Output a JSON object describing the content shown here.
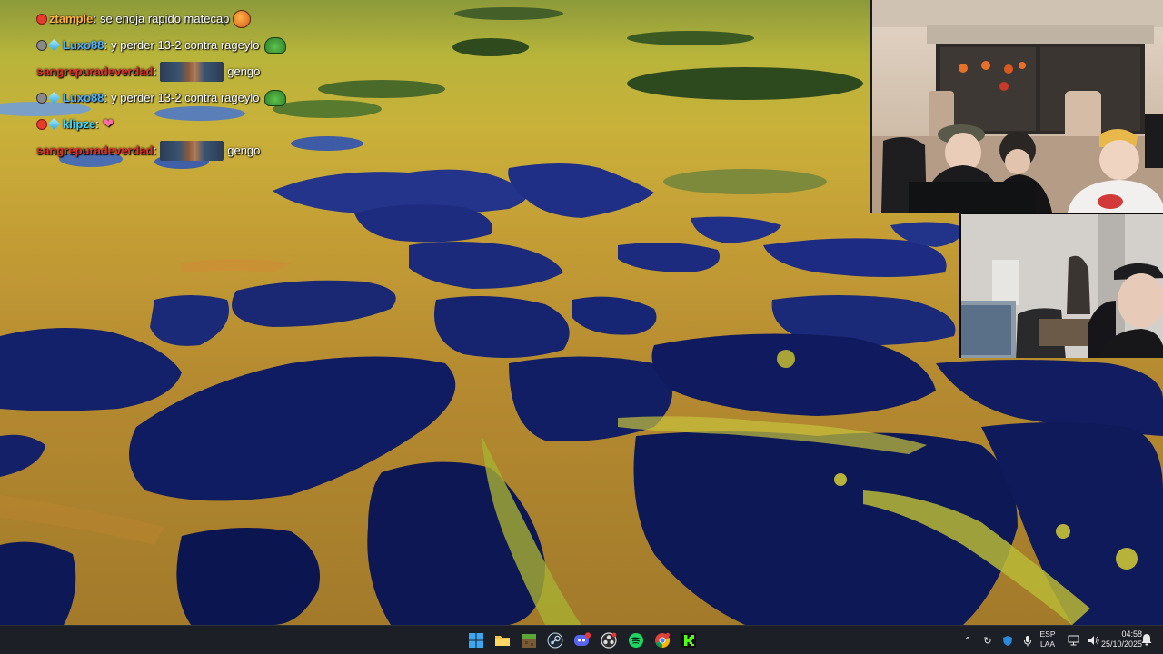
{
  "chat": {
    "messages": [
      {
        "user": "ztample",
        "user_color": "#ffb347",
        "text": "se enoja rapido matecap",
        "emote": "round"
      },
      {
        "user": "Luxo88",
        "user_color": "#4fb0ff",
        "text": "y perder 13-2 contra rageylo",
        "emote": "pepe"
      },
      {
        "user": "sangrepuradeverdad",
        "user_color": "#e0302a",
        "text": "gengo",
        "emote": "image"
      },
      {
        "user": "Luxo88",
        "user_color": "#4fb0ff",
        "text": "y perder 13-2 contra rageylo",
        "emote": "pepe"
      },
      {
        "user": "klipze",
        "user_color": "#3fd8ff",
        "text": "",
        "emote": "heart"
      },
      {
        "user": "sangrepuradeverdad",
        "user_color": "#e0302a",
        "text": "gengo",
        "emote": "image"
      }
    ]
  },
  "taskbar": {
    "apps": [
      "windows-start",
      "file-explorer",
      "minecraft",
      "steam",
      "discord",
      "obs",
      "spotify",
      "chrome",
      "kick"
    ],
    "language": {
      "line1": "ESP",
      "line2": "LAA"
    },
    "time": "04:58",
    "date": "25/10/2025"
  }
}
